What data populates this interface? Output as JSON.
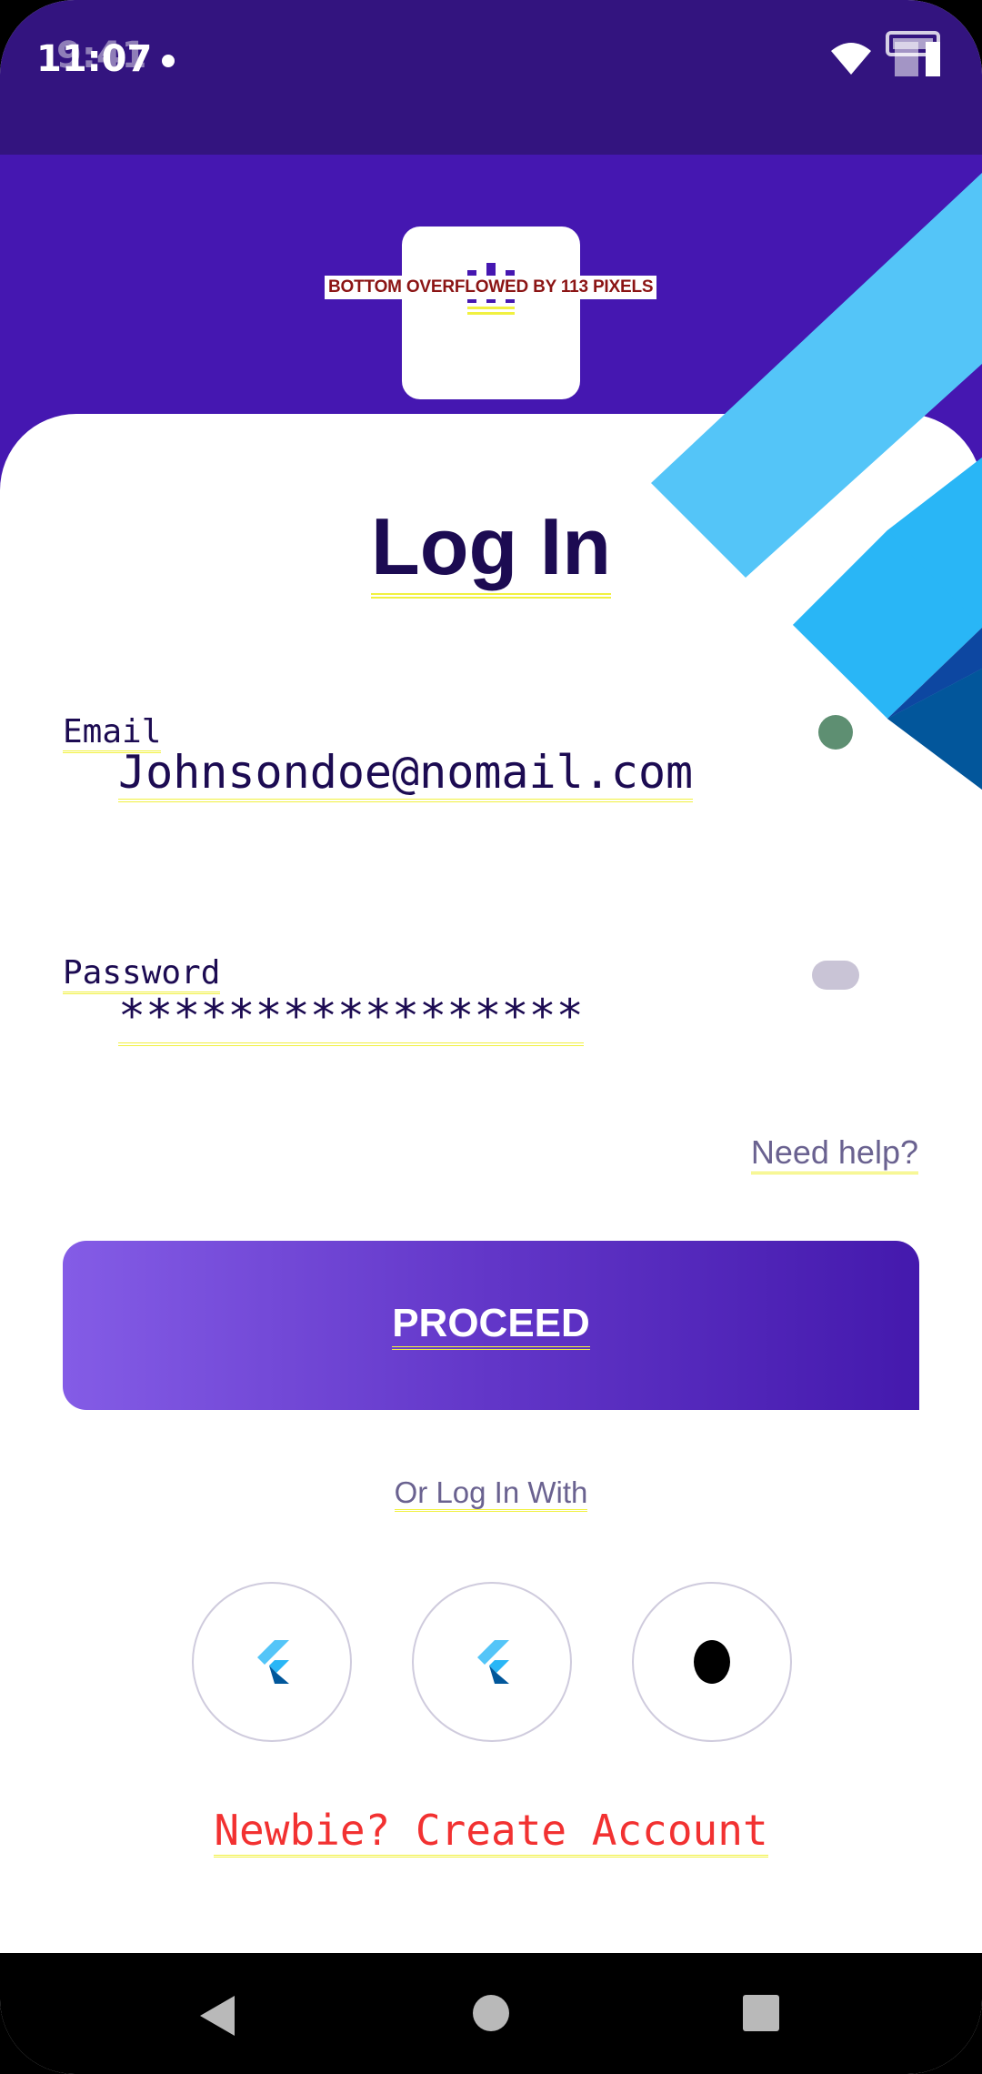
{
  "status_bar": {
    "time": "11:07",
    "time_ghost": "9:41",
    "icons": [
      "notification-dot",
      "wifi-icon",
      "battery-icon"
    ]
  },
  "header": {
    "logo_icon": "app-logo-icon",
    "overflow_warning": "BOTTOM OVERFLOWED BY 113 PIXELS"
  },
  "login": {
    "title": "Log In",
    "email_label": "Email",
    "email_value": "Johnsondoe@nomail.com",
    "password_label": "Password",
    "password_value": "*****************",
    "need_help": "Need help?",
    "proceed_label": "PROCEED ",
    "alt_login_text": "Or Log In With",
    "social_buttons": [
      "flutter-icon",
      "flutter-icon",
      "black-circle-icon"
    ],
    "create_account": "Newbie? Create Account"
  },
  "colors": {
    "status_bar": "#33147f",
    "header": "#4517b1",
    "title": "#1c0b52",
    "accent_light_blue": "#54c5f8",
    "accent_blue": "#29b6f6",
    "accent_dark_blue": "#01579b",
    "button_gradient_start": "#845ce6",
    "button_gradient_end": "#4419ad",
    "link_red": "#f23131"
  }
}
